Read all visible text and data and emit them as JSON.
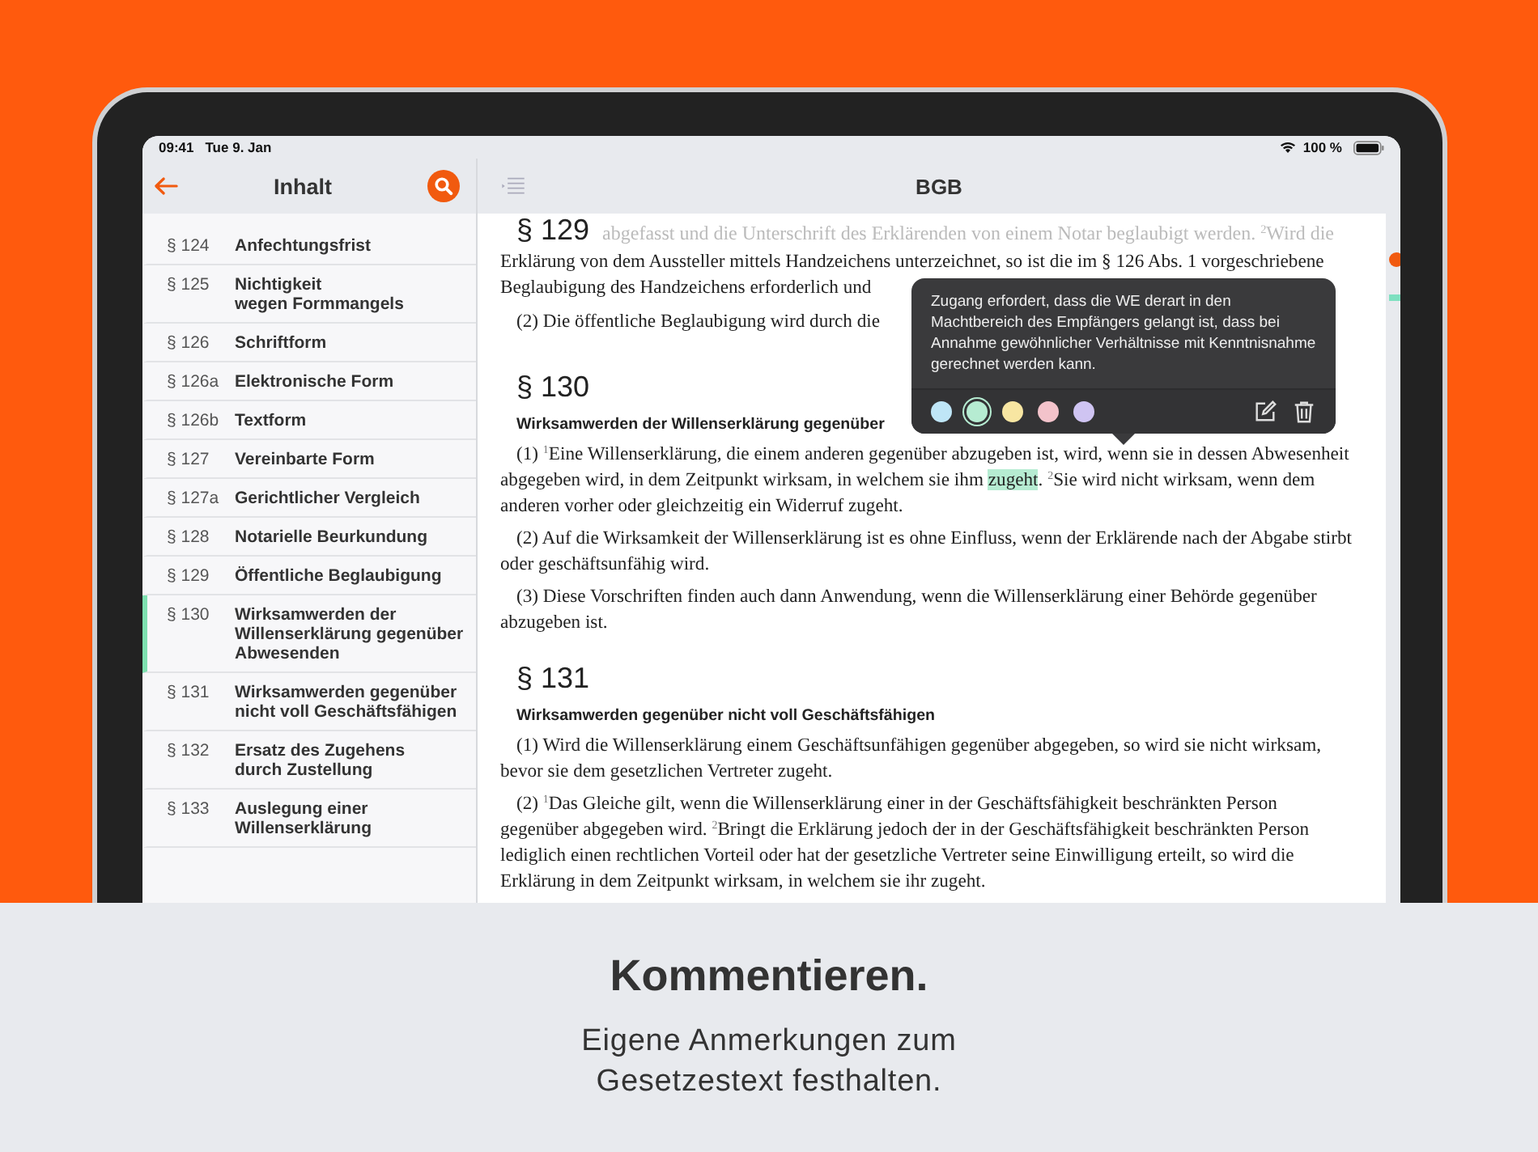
{
  "status_bar": {
    "time": "09:41",
    "date": "Tue 9. Jan",
    "battery": "100 %"
  },
  "sidebar": {
    "title": "Inhalt",
    "items": [
      {
        "number": "§ 124",
        "title": "Anfechtungsfrist",
        "selected": false
      },
      {
        "number": "§ 125",
        "title": "Nichtigkeit\nwegen Formmangels",
        "selected": false
      },
      {
        "number": "§ 126",
        "title": "Schriftform",
        "selected": false
      },
      {
        "number": "§ 126a",
        "title": "Elektronische Form",
        "selected": false
      },
      {
        "number": "§ 126b",
        "title": "Textform",
        "selected": false
      },
      {
        "number": "§ 127",
        "title": "Vereinbarte Form",
        "selected": false
      },
      {
        "number": "§ 127a",
        "title": "Gerichtlicher Vergleich",
        "selected": false
      },
      {
        "number": "§ 128",
        "title": "Notarielle Beurkundung",
        "selected": false
      },
      {
        "number": "§ 129",
        "title": "Öffentliche Beglaubigung",
        "selected": false
      },
      {
        "number": "§ 130",
        "title": "Wirksamwerden der\nWillenserklärung gegenüber\nAbwesenden",
        "selected": true
      },
      {
        "number": "§ 131",
        "title": "Wirksamwerden gegenüber\nnicht voll Geschäftsfähigen",
        "selected": false
      },
      {
        "number": "§ 132",
        "title": "Ersatz des Zugehens\ndurch Zustellung",
        "selected": false
      },
      {
        "number": "§ 133",
        "title": "Auslegung einer\nWillenserklärung",
        "selected": false
      }
    ]
  },
  "document": {
    "title": "BGB",
    "sections": [
      {
        "heading": "§ 129",
        "faded_line": "abgefasst und die Unterschrift des Erklärenden von einem Notar beglaubigt werden. $^{2}$Wird die",
        "paragraphs": [
          [
            {
              "text": "Erklärung von dem Aussteller mittels Handzeichens unterzeichnet, so ist die im § 126 Abs. 1 vorgeschriebene",
              "highlighted": false
            }
          ],
          [
            {
              "text": "Beglaubigung des Handzeichens erforderlich und",
              "highlighted": false
            }
          ],
          [
            {
              "text": "(2)  Die öffentliche Beglaubigung wird durch die",
              "highlighted": false
            }
          ]
        ]
      },
      {
        "heading": "§ 130",
        "subtitle": "Wirksamwerden der Willenserklärung gegenüber",
        "paragraphs": [
          [
            {
              "text": "(1)  $^{1}$Eine Willenserklärung, die einem anderen gegenüber abzugeben ist, wird, wenn sie in dessen Abwesenheit abgegeben wird, in dem Zeitpunkt wirksam, in welchem sie ihm ",
              "highlighted": false
            },
            {
              "text": "zugeht",
              "highlighted": true
            },
            {
              "text": ". $^{2}$Sie wird nicht wirksam, wenn dem anderen vorher oder gleichzeitig ein Widerruf zugeht.",
              "highlighted": false
            }
          ],
          [
            {
              "text": "(2)  Auf die Wirksamkeit der Willenserklärung ist es ohne Einfluss, wenn der Erklärende nach der Abgabe stirbt oder geschäftsunfähig wird.",
              "highlighted": false
            }
          ],
          [
            {
              "text": "(3)  Diese Vorschriften finden auch dann Anwendung, wenn die Willenserklärung einer Behörde gegenüber abzugeben ist.",
              "highlighted": false
            }
          ]
        ]
      },
      {
        "heading": "§ 131",
        "subtitle": "Wirksamwerden gegenüber nicht voll Geschäftsfähigen",
        "paragraphs": [
          [
            {
              "text": "(1)  Wird die Willenserklärung einem Geschäftsunfähigen gegenüber abgegeben, so wird sie nicht wirksam, bevor sie dem gesetzlichen Vertreter zugeht.",
              "highlighted": false
            }
          ],
          [
            {
              "text": "(2)  $^{1}$Das Gleiche gilt, wenn die Willenserklärung einer in der Geschäftsfähigkeit beschränkten Person gegenüber abgegeben wird.  $^{2}$Bringt die Erklärung jedoch der in der Geschäftsfähigkeit beschränkten Person lediglich einen rechtlichen Vorteil oder hat der gesetzliche Vertreter seine Einwilligung erteilt, so wird die Erklärung in dem Zeitpunkt wirksam, in welchem sie ihr zugeht.",
              "highlighted": false
            }
          ]
        ]
      }
    ]
  },
  "note_popover": {
    "text": "Zugang erfordert, dass die WE derart in den Machtbereich des Empfängers gelangt ist, dass bei Annahme gewöhnlicher Verhältnisse mit Kenntnisnahme gerechnet werden kann.",
    "colors": [
      {
        "color": "#bfe6f7",
        "selected": false
      },
      {
        "color": "#b6ecd2",
        "selected": true
      },
      {
        "color": "#f8e6a2",
        "selected": false
      },
      {
        "color": "#f3c3cb",
        "selected": false
      },
      {
        "color": "#cfc4f2",
        "selected": false
      }
    ]
  },
  "caption": {
    "title": "Kommentieren.",
    "subtitle": "Eigene Anmerkungen zum\nGesetzestext festhalten."
  }
}
